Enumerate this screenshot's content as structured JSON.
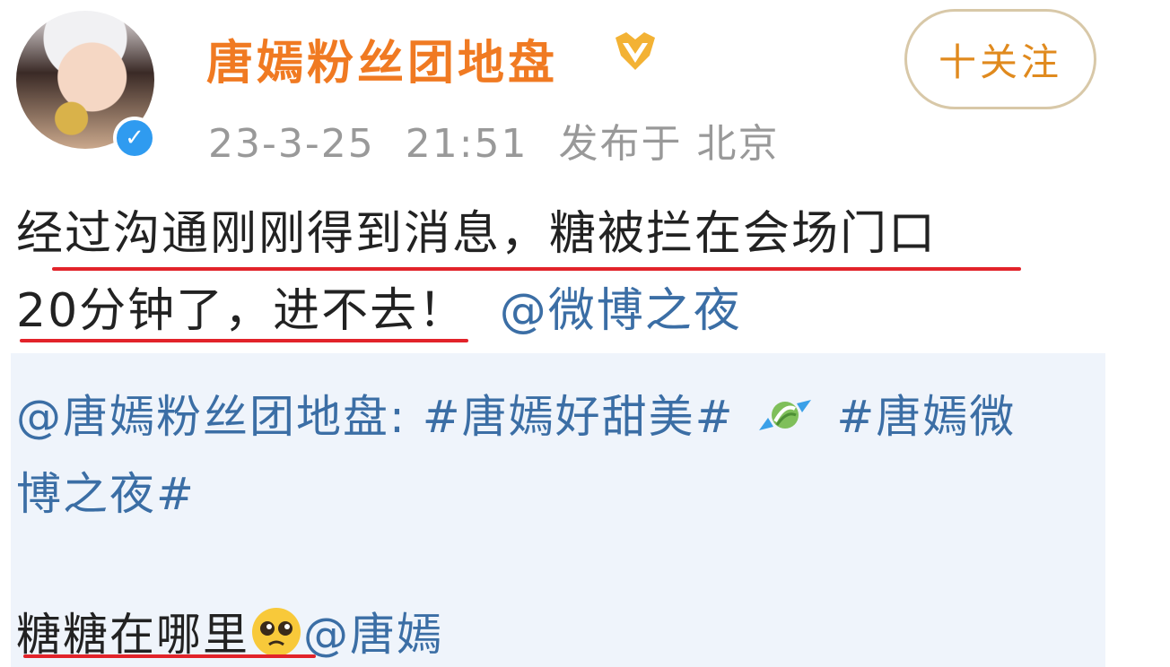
{
  "post": {
    "username": "唐嫣粉丝团地盘",
    "date": "23-3-25",
    "time": "21:51",
    "location": "发布于 北京",
    "follow_label": "十关注",
    "body_line1": "经过沟通刚刚得到消息，糖被拦在会场门口",
    "body_line2_text": "20分钟了，进不去！",
    "body_line2_mention": "@微博之夜"
  },
  "repost": {
    "line1_prefix": "@唐嫣粉丝团地盘: #唐嫣好甜美#",
    "line1_suffix": "#唐嫣微",
    "line2": "博之夜#"
  },
  "footer": {
    "text": "糖糖在哪里",
    "mention": "@唐嫣"
  },
  "colors": {
    "username": "#f07a22",
    "mention": "#3b6ea5",
    "underline": "#e2232a",
    "repost_bg": "#eff4fb"
  },
  "icons": [
    "verified-icon",
    "vip-badge-icon",
    "candy-emoji-icon",
    "pleading-face-emoji-icon"
  ]
}
